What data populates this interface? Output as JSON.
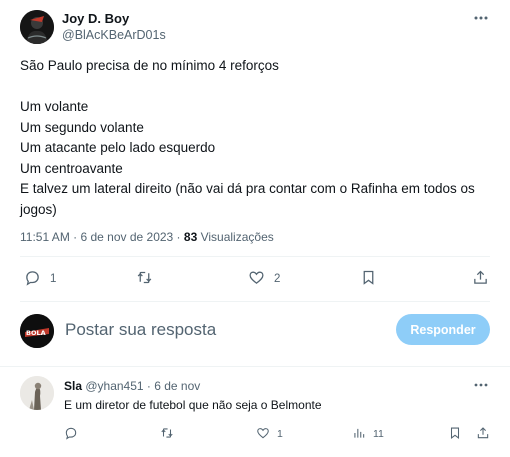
{
  "post": {
    "author_name": "Joy D. Boy",
    "author_handle": "@BlAcKBeArD01s",
    "body": "São Paulo precisa de no mínimo 4 reforços\n\nUm volante\nUm segundo volante\nUm atacante pelo lado esquerdo\nUm centroavante\nE talvez um lateral direito (não vai dá pra contar com o Rafinha em todos os jogos)",
    "timestamp": "11:51 AM · 6 de nov de 2023 · ",
    "view_count": "83",
    "view_label": " Visualizações",
    "replies": "1",
    "likes": "2",
    "icons": [
      "more-icon",
      "reply-icon",
      "retweet-icon",
      "like-icon",
      "bookmark-icon",
      "share-icon"
    ]
  },
  "compose": {
    "placeholder": "Postar sua resposta",
    "button_label": "Responder",
    "button_color": "#8ecdf8",
    "avatar_text": "BOLA"
  },
  "comment": {
    "name": "Sla",
    "handle_date": " @yhan451 · 6 de nov",
    "text": "E um diretor de futebol que não seja o Belmonte",
    "replies": "",
    "likes": "1",
    "views": "11"
  }
}
